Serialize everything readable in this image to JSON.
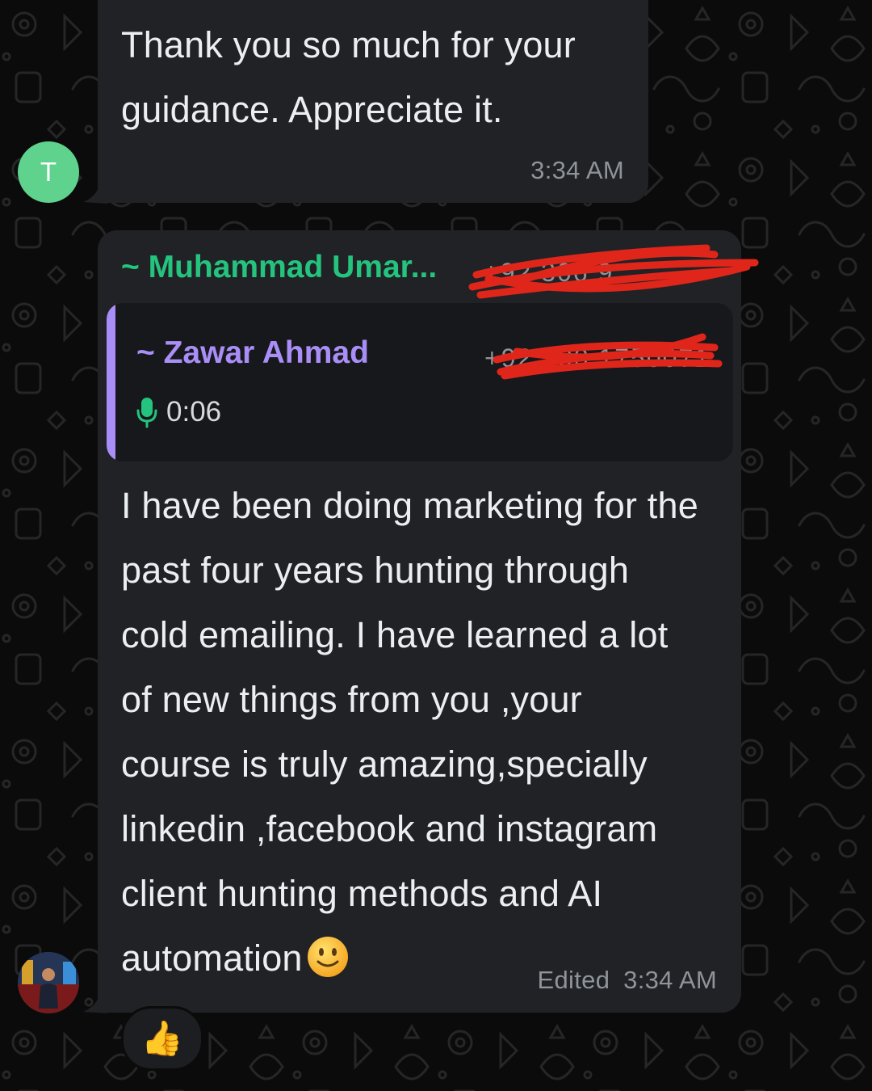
{
  "messages": [
    {
      "avatar_letter": "T",
      "text": "Thank you so much for your\nguidance. Appreciate it.",
      "time": "3:34 AM"
    },
    {
      "sender": "~ Muhammad Umar...",
      "sender_phone": "+92 306 9...",
      "reply": {
        "name": "~ Zawar Ahmad",
        "phone": "+92 300 1750071",
        "voice_duration": "0:06"
      },
      "text": "I have been doing marketing for the\npast four years hunting through\ncold emailing. I have learned a lot\nof new things from you ,your\ncourse is truly amazing,specially\nlinkedin ,facebook and instagram\nclient hunting methods and AI\nautomation",
      "edited_label": "Edited",
      "time": "3:34 AM",
      "reaction": "👍"
    }
  ],
  "colors": {
    "background": "#0b0b0b",
    "bubble": "#212226",
    "sender_green": "#25c47e",
    "quote_purple": "#a98ef7",
    "redaction_red": "#e0261a"
  },
  "icons": [
    "mic-icon",
    "smiley-emoji",
    "thumbs-up-emoji"
  ]
}
